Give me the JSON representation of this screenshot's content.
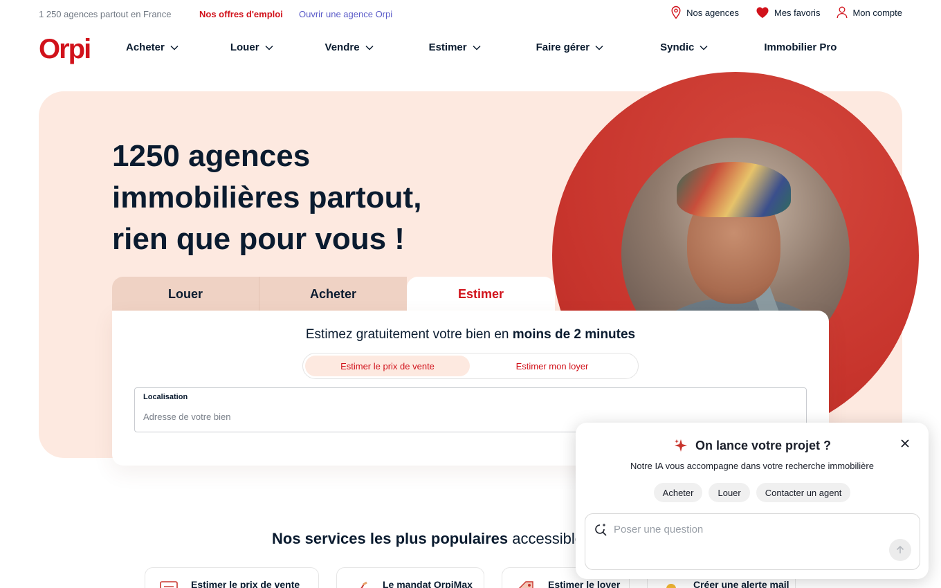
{
  "topbar": {
    "count_text": "1 250 agences partout en France",
    "jobs_link": "Nos offres d'emploi",
    "open_agency_link": "Ouvrir une agence Orpi",
    "links": [
      {
        "label": "Nos agences",
        "icon": "location-pin-icon"
      },
      {
        "label": "Mes favoris",
        "icon": "heart-icon"
      },
      {
        "label": "Mon compte",
        "icon": "user-icon"
      }
    ]
  },
  "nav": {
    "logo_text": "Orpi",
    "items": [
      {
        "label": "Acheter"
      },
      {
        "label": "Louer"
      },
      {
        "label": "Vendre"
      },
      {
        "label": "Estimer"
      },
      {
        "label": "Faire gérer"
      },
      {
        "label": "Syndic"
      },
      {
        "label": "Immobilier Pro"
      }
    ]
  },
  "hero": {
    "title_bold_1": "1250 agences",
    "title_bold_2": "immobilières",
    "title_rest_2": " partout,",
    "title_line_3": "rien que pour vous !",
    "tabs": [
      {
        "label": "Louer"
      },
      {
        "label": "Acheter"
      },
      {
        "label": "Estimer"
      }
    ],
    "active_tab": "Estimer"
  },
  "estimate_card": {
    "heading_prefix": "Estimez gratuitement votre bien en ",
    "heading_bold": "moins de 2 minutes",
    "options": [
      {
        "label": "Estimer le prix de vente"
      },
      {
        "label": "Estimer mon loyer"
      }
    ],
    "selected_option": "Estimer le prix de vente",
    "location_label": "Localisation",
    "location_placeholder": "Adresse de votre bien",
    "location_value": ""
  },
  "services": {
    "title_bold": "Nos services les plus populaires",
    "title_rest": " accessible",
    "items": [
      {
        "label": "Estimer le prix de vente",
        "icon": "document-icon"
      },
      {
        "label": "Le mandat OrpiMax",
        "icon": "pen-icon"
      },
      {
        "label": "Estimer le loyer",
        "icon": "tag-icon"
      },
      {
        "label": "Créer une alerte mail",
        "icon": "bell-icon"
      }
    ]
  },
  "chat": {
    "title": "On lance votre projet ?",
    "subtitle": "Notre IA vous accompagne dans votre recherche immobilière",
    "chips": [
      {
        "label": "Acheter"
      },
      {
        "label": "Louer"
      },
      {
        "label": "Contacter un agent"
      }
    ],
    "input_placeholder": "Poser une question",
    "input_value": ""
  },
  "colors": {
    "brand_red": "#d1121b",
    "hero_bg": "#fde9e0",
    "tab_bg": "#efd2c4",
    "link_purple": "#5a5bc8",
    "text_dark": "#0a1b2f"
  }
}
